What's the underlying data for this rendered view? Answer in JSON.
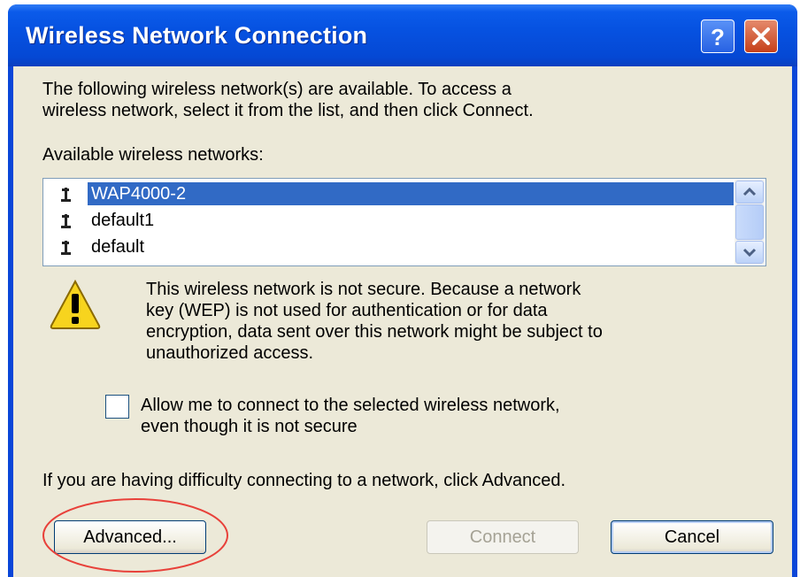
{
  "window": {
    "title": "Wireless Network Connection",
    "help_label": "?",
    "close_label": "✕"
  },
  "intro": {
    "line1": "The following wireless network(s) are available. To access a",
    "line2": "wireless network, select it from the list, and then click Connect."
  },
  "networks": {
    "label": "Available wireless networks:",
    "items": [
      {
        "name": "WAP4000-2",
        "selected": true
      },
      {
        "name": "default1",
        "selected": false
      },
      {
        "name": "default",
        "selected": false
      }
    ]
  },
  "warning": {
    "line1": "This wireless network is not secure. Because a network",
    "line2": "key (WEP) is not used for authentication or for data",
    "line3": "encryption, data sent over this network might be subject to",
    "line4": "unauthorized access."
  },
  "allow_insecure": {
    "checked": false,
    "line1": "Allow me to connect to the selected wireless network,",
    "line2": "even though it is not secure"
  },
  "help_text": "If you are having difficulty connecting to a network, click Advanced.",
  "buttons": {
    "advanced": "Advanced...",
    "connect": "Connect",
    "cancel": "Cancel"
  },
  "colors": {
    "title_bar": "#0552dc",
    "selection": "#316ac5",
    "dialog_bg": "#ece9d8",
    "annotation": "#e8413a"
  },
  "icons": {
    "network": "wireless-network-icon",
    "warning": "warning-triangle-icon",
    "help": "help-icon",
    "close": "close-icon"
  }
}
